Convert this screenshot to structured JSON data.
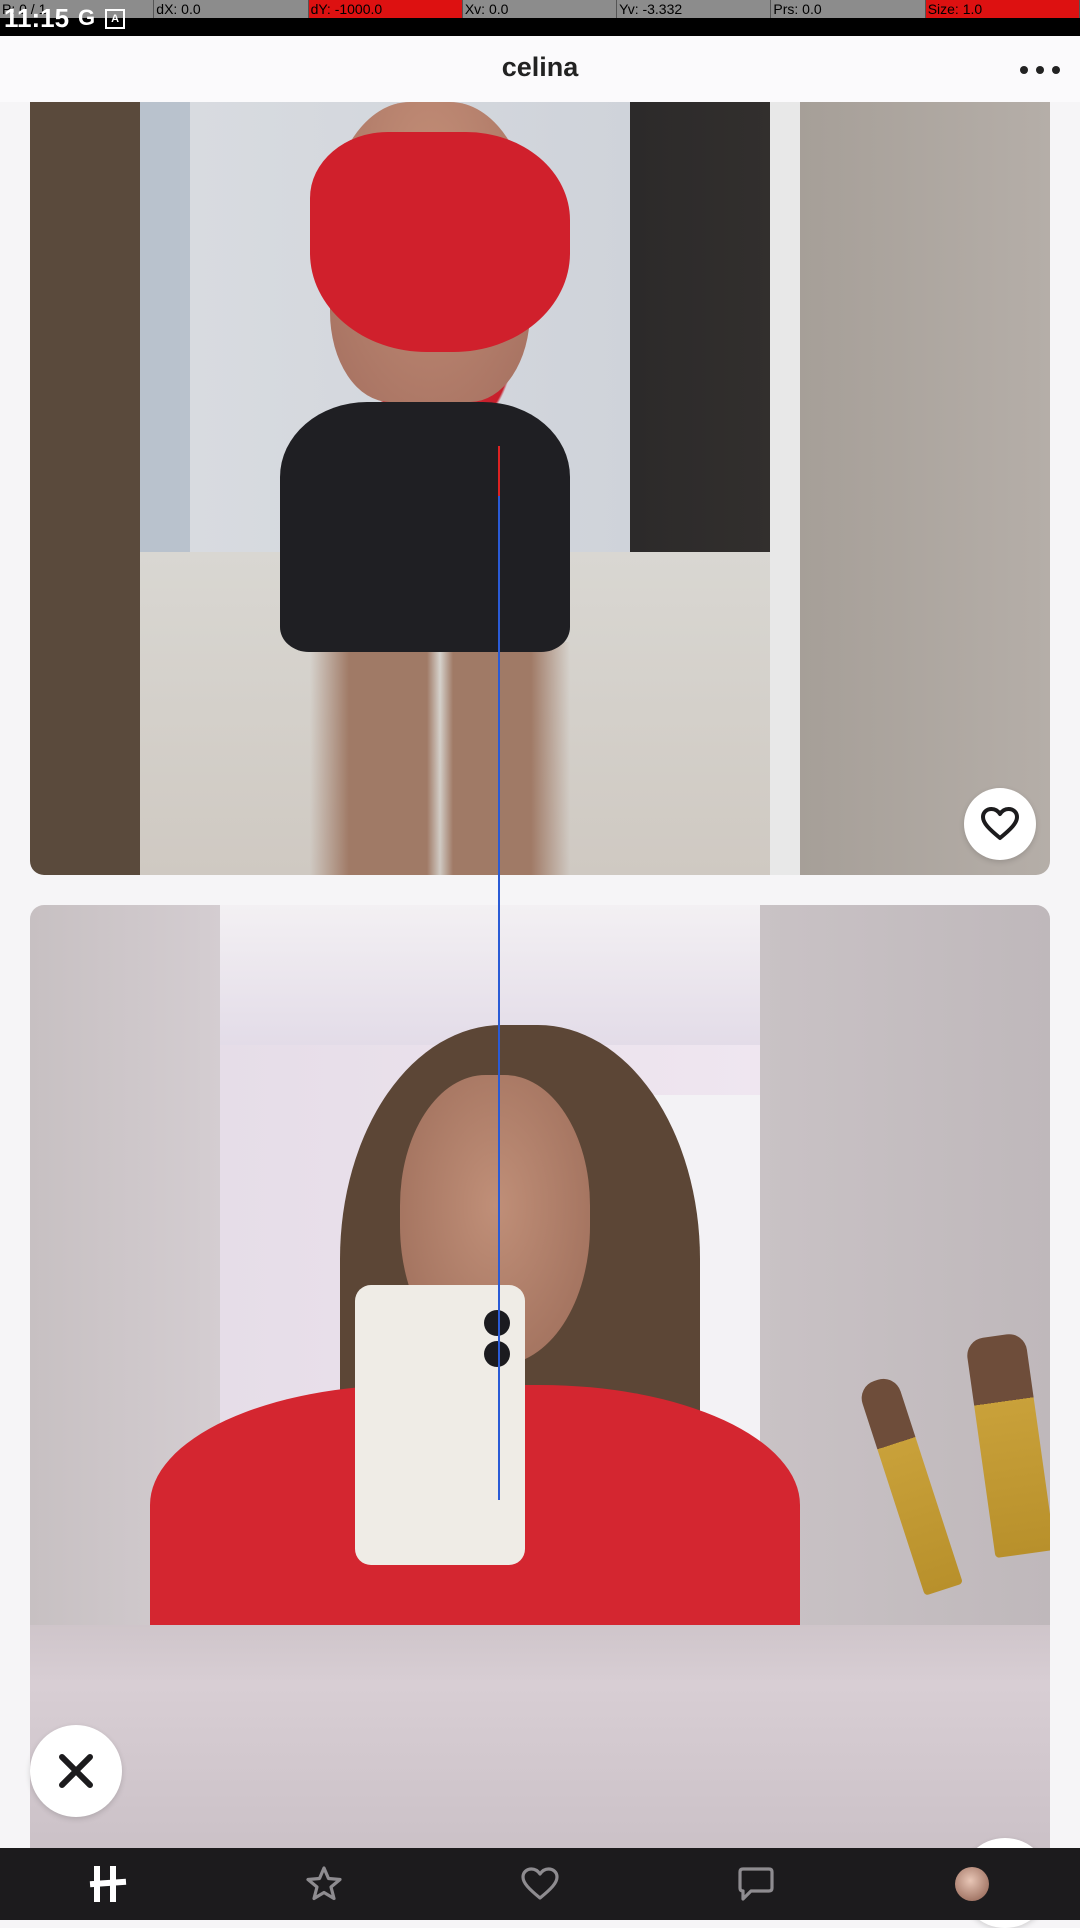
{
  "debug_bar": {
    "pointer": "P: 0 / 1",
    "dx": "dX: 0.0",
    "dy": "dY: -1000.0",
    "xv": "Xv: 0.0",
    "yv": "Yv: -3.332",
    "prs": "Prs: 0.0",
    "size": "Size: 1.0"
  },
  "status_bar": {
    "time": "11:15",
    "icons": [
      "google-icon",
      "app-notification-icon"
    ]
  },
  "header": {
    "title": "celina",
    "menu_icon": "more-horizontal-icon"
  },
  "photos": [
    {
      "like_icon": "heart-outline-icon"
    },
    {}
  ],
  "actions": {
    "dismiss_icon": "close-x-icon"
  },
  "bottom_nav": {
    "items": [
      {
        "icon": "hinge-logo-icon",
        "active": true
      },
      {
        "icon": "star-icon",
        "active": false
      },
      {
        "icon": "heart-icon",
        "active": false
      },
      {
        "icon": "chat-bubble-icon",
        "active": false
      },
      {
        "icon": "profile-avatar",
        "active": false
      }
    ]
  },
  "colors": {
    "nav_background": "#1c1b1d",
    "page_background": "#f6f5f7",
    "debug_red": "#dd1111",
    "debug_gray": "#8c8c8c"
  }
}
